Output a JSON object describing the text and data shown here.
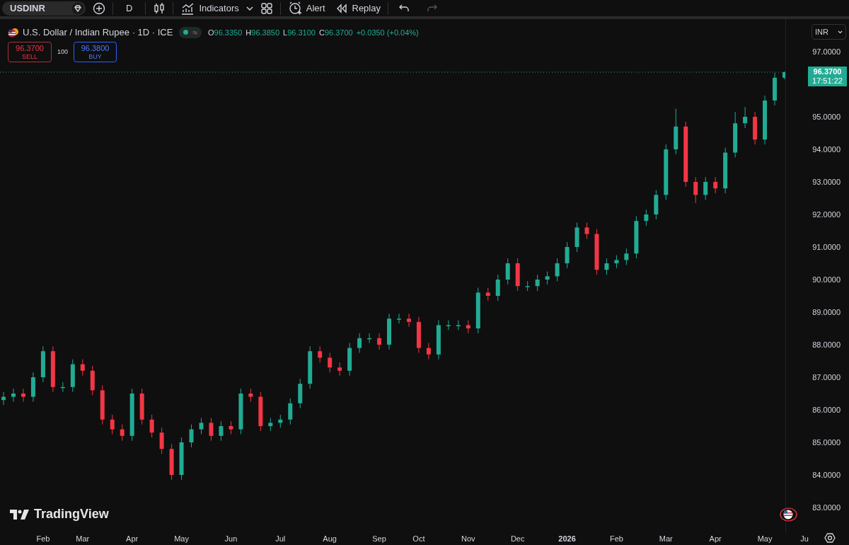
{
  "toolbar": {
    "symbol": "USDINR",
    "interval": "D",
    "indicators_label": "Indicators",
    "alert_label": "Alert",
    "replay_label": "Replay",
    "undo_disabled": false,
    "redo_disabled": true
  },
  "legend": {
    "title": "U.S. Dollar / Indian Rupee · 1D · ICE",
    "status_symbol": "≈",
    "ohlc": [
      {
        "label": "O",
        "value": "96.3350"
      },
      {
        "label": "H",
        "value": "96.3850"
      },
      {
        "label": "L",
        "value": "96.3100"
      },
      {
        "label": "C",
        "value": "96.3700"
      }
    ],
    "change": "+0.0350 (+0.04%)"
  },
  "trade": {
    "sell_price": "96.3700",
    "sell_label": "SELL",
    "spread": "100",
    "buy_price": "96.3800",
    "buy_label": "BUY"
  },
  "currency": "INR",
  "last_price": {
    "price": "96.3700",
    "time": "17:51:22"
  },
  "brand": "TradingView",
  "chart_data": {
    "type": "candlestick",
    "ylim": [
      83,
      97
    ],
    "ref_lines": [
      {
        "axis": "y",
        "value": 96.37,
        "color": "#22ab94"
      }
    ],
    "yticks": [
      {
        "value": 97,
        "label": "97.0000"
      },
      {
        "value": 95,
        "label": "95.0000"
      },
      {
        "value": 94,
        "label": "94.0000"
      },
      {
        "value": 93,
        "label": "93.0000"
      },
      {
        "value": 92,
        "label": "92.0000"
      },
      {
        "value": 91,
        "label": "91.0000"
      },
      {
        "value": 90,
        "label": "90.0000"
      },
      {
        "value": 89,
        "label": "89.0000"
      },
      {
        "value": 88,
        "label": "88.0000"
      },
      {
        "value": 87,
        "label": "87.0000"
      },
      {
        "value": 86,
        "label": "86.0000"
      },
      {
        "value": 85,
        "label": "85.0000"
      },
      {
        "value": 84,
        "label": "84.0000"
      },
      {
        "value": 83,
        "label": "83.0000"
      }
    ],
    "categories": [
      null,
      null,
      null,
      null,
      "Feb",
      null,
      null,
      null,
      "Mar",
      null,
      null,
      null,
      null,
      "Apr",
      null,
      null,
      null,
      null,
      "May",
      null,
      null,
      null,
      null,
      "Jun",
      null,
      null,
      null,
      null,
      "Jul",
      null,
      null,
      null,
      null,
      "Aug",
      null,
      null,
      null,
      null,
      "Sep",
      null,
      null,
      null,
      "Oct",
      null,
      null,
      null,
      null,
      "Nov",
      null,
      null,
      null,
      null,
      "Dec",
      null,
      null,
      null,
      null,
      "2026",
      null,
      null,
      null,
      null,
      "Feb",
      null,
      null,
      null,
      null,
      "Mar",
      null,
      null,
      null,
      null,
      "Apr",
      null,
      null,
      null,
      null,
      "May",
      null,
      null,
      null,
      "Ju"
    ],
    "ohlc": [
      [
        86.3,
        86.55,
        86.15,
        86.4
      ],
      [
        86.4,
        86.65,
        86.25,
        86.5
      ],
      [
        86.5,
        86.65,
        86.25,
        86.4
      ],
      [
        86.4,
        87.15,
        86.25,
        87.0
      ],
      [
        87.0,
        87.95,
        86.85,
        87.8
      ],
      [
        87.8,
        87.95,
        86.55,
        86.7
      ],
      [
        86.7,
        86.85,
        86.55,
        86.7
      ],
      [
        86.7,
        87.55,
        86.55,
        87.4
      ],
      [
        87.4,
        87.55,
        87.05,
        87.2
      ],
      [
        87.2,
        87.35,
        86.45,
        86.6
      ],
      [
        86.6,
        86.75,
        85.55,
        85.7
      ],
      [
        85.7,
        85.85,
        85.25,
        85.4
      ],
      [
        85.4,
        85.55,
        85.05,
        85.2
      ],
      [
        85.2,
        86.65,
        85.05,
        86.5
      ],
      [
        86.5,
        86.65,
        85.55,
        85.7
      ],
      [
        85.7,
        85.85,
        85.15,
        85.3
      ],
      [
        85.3,
        85.45,
        84.65,
        84.8
      ],
      [
        84.8,
        84.95,
        83.85,
        84.0
      ],
      [
        84.0,
        85.15,
        83.85,
        85.0
      ],
      [
        85.0,
        85.55,
        84.85,
        85.4
      ],
      [
        85.4,
        85.75,
        85.25,
        85.6
      ],
      [
        85.6,
        85.75,
        85.05,
        85.2
      ],
      [
        85.2,
        85.65,
        85.05,
        85.5
      ],
      [
        85.5,
        85.65,
        85.25,
        85.4
      ],
      [
        85.4,
        86.65,
        85.25,
        86.5
      ],
      [
        86.5,
        86.65,
        86.25,
        86.4
      ],
      [
        86.4,
        86.55,
        85.35,
        85.5
      ],
      [
        85.5,
        85.75,
        85.35,
        85.6
      ],
      [
        85.6,
        85.85,
        85.45,
        85.7
      ],
      [
        85.7,
        86.35,
        85.55,
        86.2
      ],
      [
        86.2,
        86.95,
        86.05,
        86.8
      ],
      [
        86.8,
        87.95,
        86.65,
        87.8
      ],
      [
        87.8,
        87.95,
        87.45,
        87.6
      ],
      [
        87.6,
        87.75,
        87.15,
        87.3
      ],
      [
        87.3,
        87.45,
        87.05,
        87.2
      ],
      [
        87.2,
        88.05,
        87.05,
        87.9
      ],
      [
        87.9,
        88.35,
        87.75,
        88.2
      ],
      [
        88.2,
        88.35,
        88.05,
        88.2
      ],
      [
        88.2,
        88.35,
        87.85,
        88.0
      ],
      [
        88.0,
        88.95,
        87.85,
        88.8
      ],
      [
        88.8,
        88.95,
        88.65,
        88.8
      ],
      [
        88.8,
        88.95,
        88.55,
        88.7
      ],
      [
        88.7,
        88.85,
        87.75,
        87.9
      ],
      [
        87.9,
        88.05,
        87.55,
        87.7
      ],
      [
        87.7,
        88.75,
        87.55,
        88.6
      ],
      [
        88.6,
        88.75,
        88.45,
        88.6
      ],
      [
        88.6,
        88.75,
        88.45,
        88.6
      ],
      [
        88.6,
        88.75,
        88.35,
        88.5
      ],
      [
        88.5,
        89.75,
        88.35,
        89.6
      ],
      [
        89.6,
        89.75,
        89.35,
        89.5
      ],
      [
        89.5,
        90.15,
        89.35,
        90.0
      ],
      [
        90.0,
        90.65,
        89.85,
        90.5
      ],
      [
        90.5,
        90.65,
        89.65,
        89.8
      ],
      [
        89.8,
        89.95,
        89.65,
        89.8
      ],
      [
        89.8,
        90.15,
        89.65,
        90.0
      ],
      [
        90.0,
        90.25,
        89.85,
        90.1
      ],
      [
        90.1,
        90.65,
        89.95,
        90.5
      ],
      [
        90.5,
        91.15,
        90.35,
        91.0
      ],
      [
        91.0,
        91.75,
        90.85,
        91.6
      ],
      [
        91.6,
        91.75,
        91.25,
        91.4
      ],
      [
        91.4,
        91.55,
        90.15,
        90.3
      ],
      [
        90.3,
        90.65,
        90.15,
        90.5
      ],
      [
        90.5,
        90.75,
        90.35,
        90.6
      ],
      [
        90.6,
        90.95,
        90.45,
        90.8
      ],
      [
        90.8,
        91.95,
        90.65,
        91.8
      ],
      [
        91.8,
        92.15,
        91.65,
        92.0
      ],
      [
        92.0,
        92.75,
        91.85,
        92.6
      ],
      [
        92.6,
        94.15,
        92.45,
        94.0
      ],
      [
        94.0,
        95.25,
        93.85,
        94.7
      ],
      [
        94.7,
        94.85,
        92.85,
        93.0
      ],
      [
        93.0,
        93.15,
        92.35,
        92.6
      ],
      [
        92.6,
        93.15,
        92.45,
        93.0
      ],
      [
        93.0,
        93.15,
        92.65,
        92.8
      ],
      [
        92.8,
        94.05,
        92.65,
        93.9
      ],
      [
        93.9,
        95.15,
        93.75,
        94.8
      ],
      [
        94.8,
        95.3,
        94.65,
        95.0
      ],
      [
        95.0,
        95.15,
        94.15,
        94.3
      ],
      [
        94.3,
        95.65,
        94.15,
        95.5
      ],
      [
        95.5,
        96.35,
        95.35,
        96.2
      ],
      [
        96.2,
        96.39,
        96.15,
        96.37
      ],
      null,
      null
    ]
  }
}
